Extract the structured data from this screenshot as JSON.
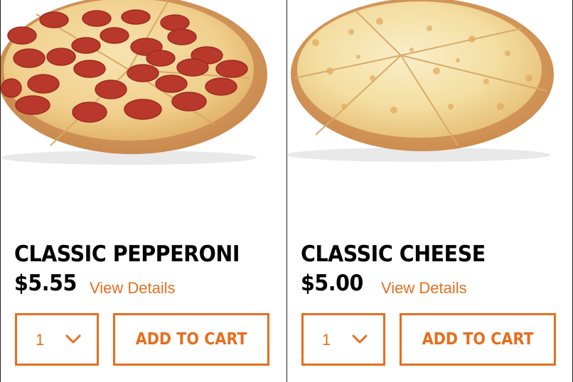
{
  "products": [
    {
      "name": "CLASSIC PEPPERONI",
      "price": "$5.55",
      "details_label": "View Details",
      "quantity": "1",
      "add_label": "ADD TO CART",
      "image_icon": "pepperoni-pizza-image"
    },
    {
      "name": "CLASSIC CHEESE",
      "price": "$5.00",
      "details_label": "View Details",
      "quantity": "1",
      "add_label": "ADD TO CART",
      "image_icon": "cheese-pizza-image"
    }
  ],
  "colors": {
    "accent": "#e66e1e",
    "text": "#000000",
    "divider": "#222222"
  }
}
